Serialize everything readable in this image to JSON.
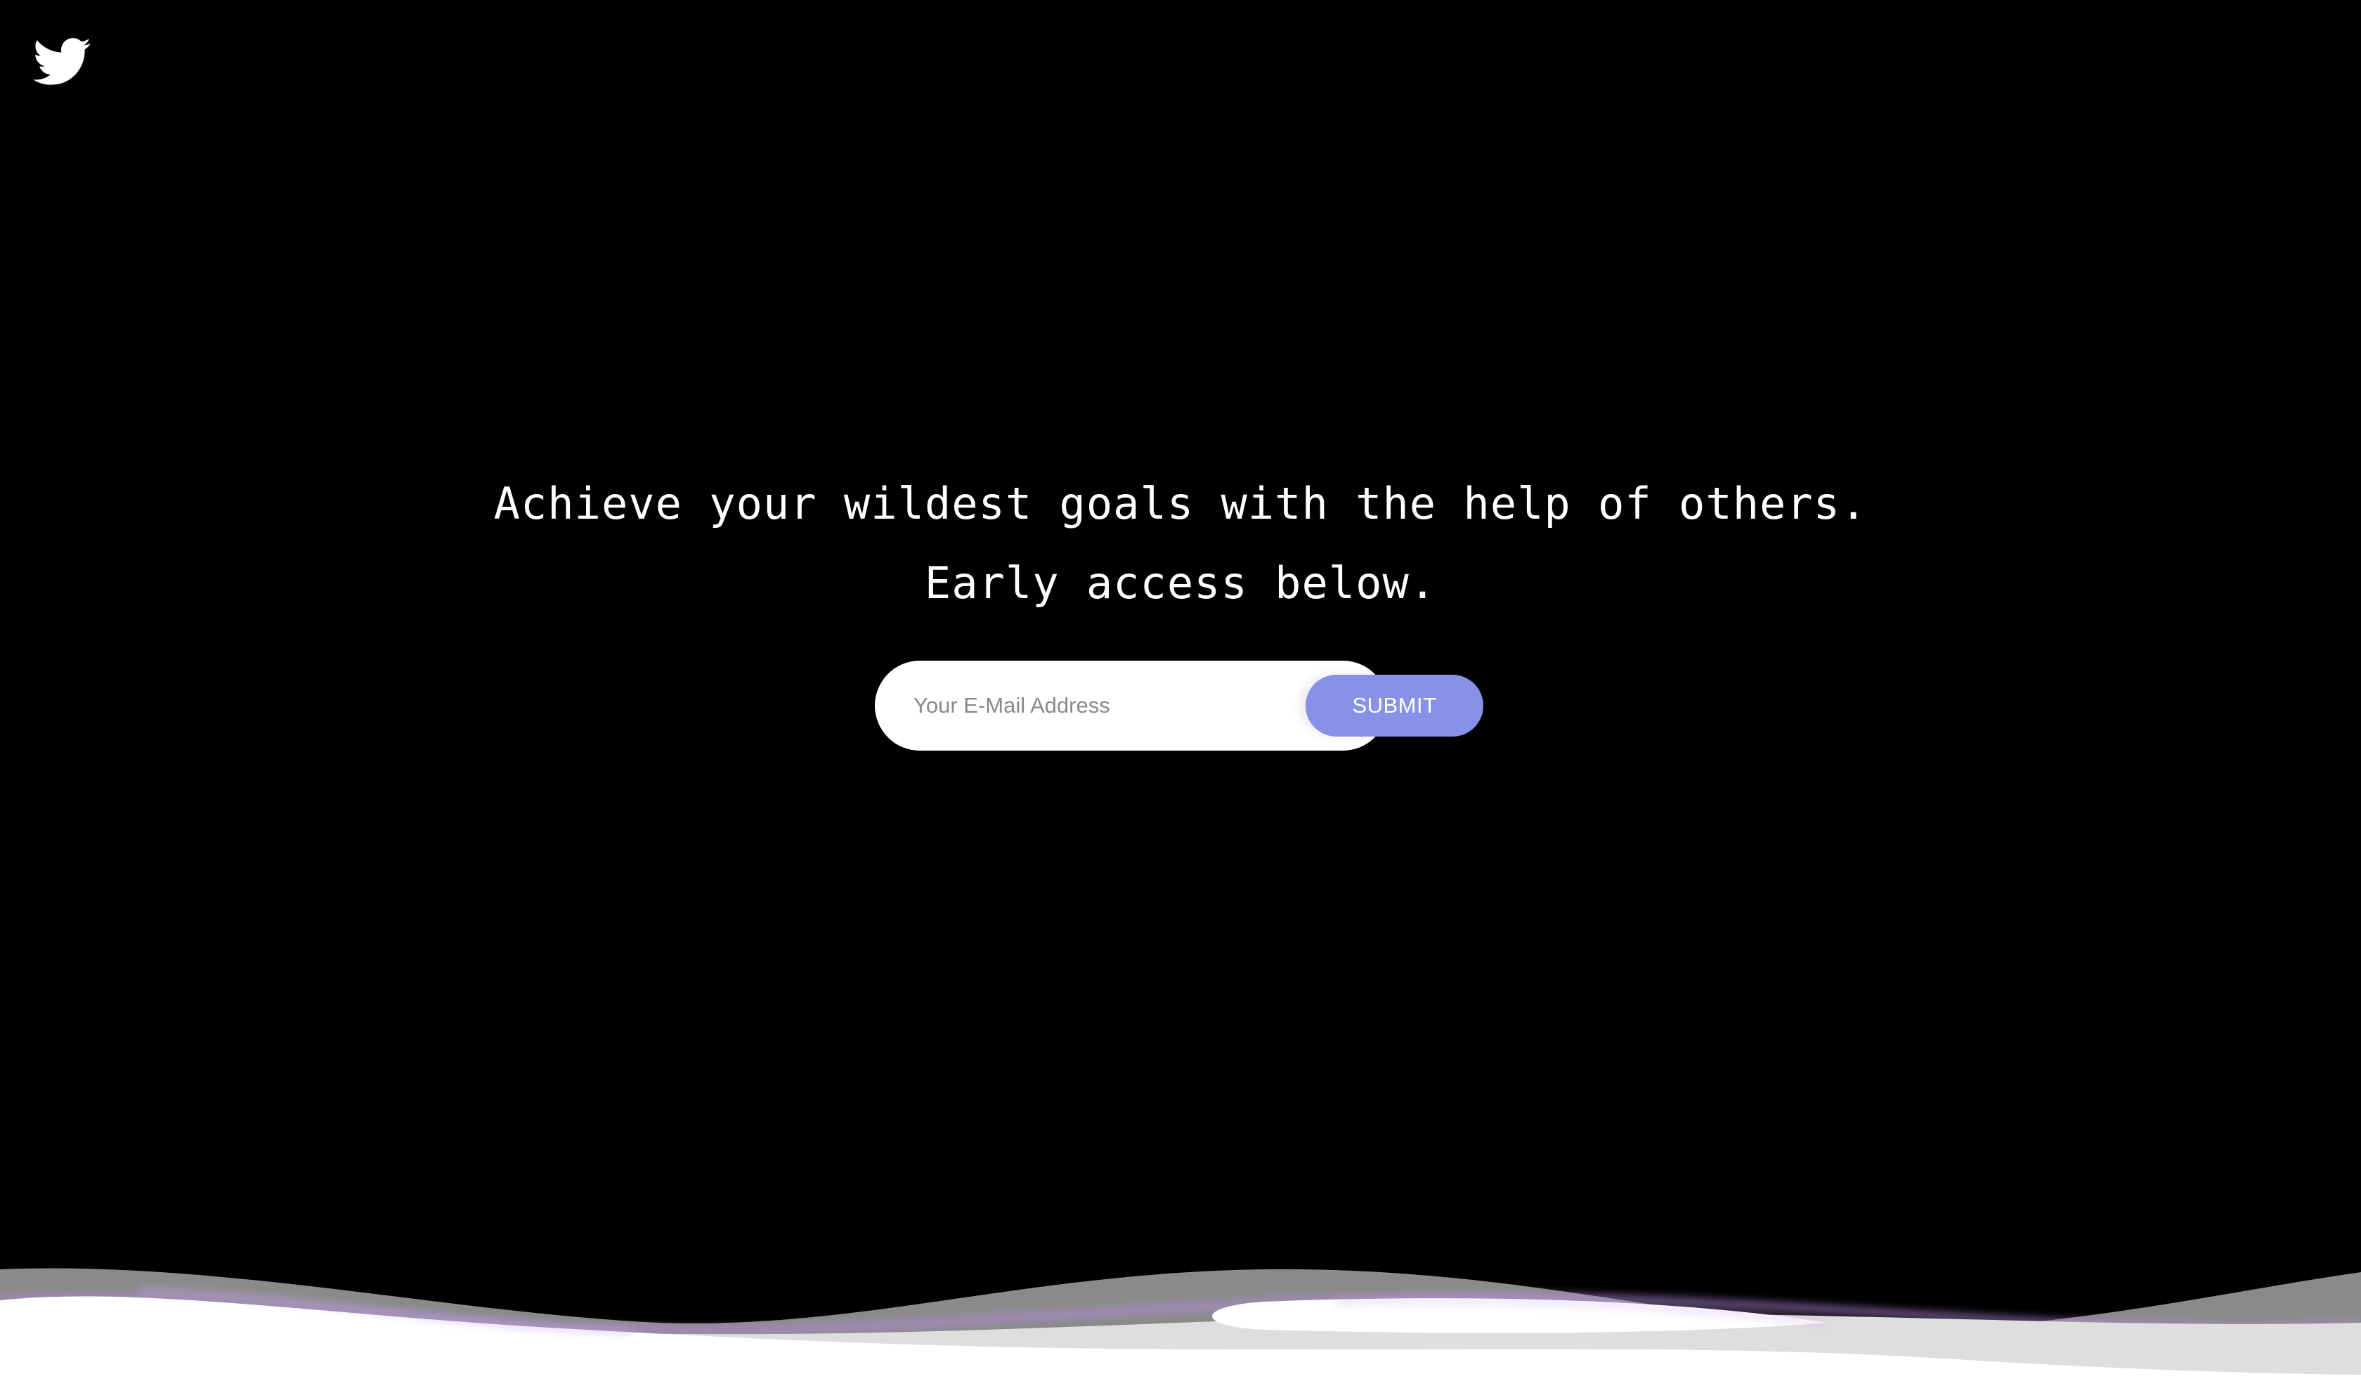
{
  "logo": {
    "icon": "twitter-bird-icon"
  },
  "hero": {
    "line1": "Achieve your wildest goals with the help of others.",
    "line2": "Early access below."
  },
  "signup": {
    "email_placeholder": "Your E-Mail Address",
    "email_value": "",
    "submit_label": "SUBMIT"
  },
  "colors": {
    "background": "#000000",
    "accent": "#8791e8",
    "text": "#ffffff"
  }
}
